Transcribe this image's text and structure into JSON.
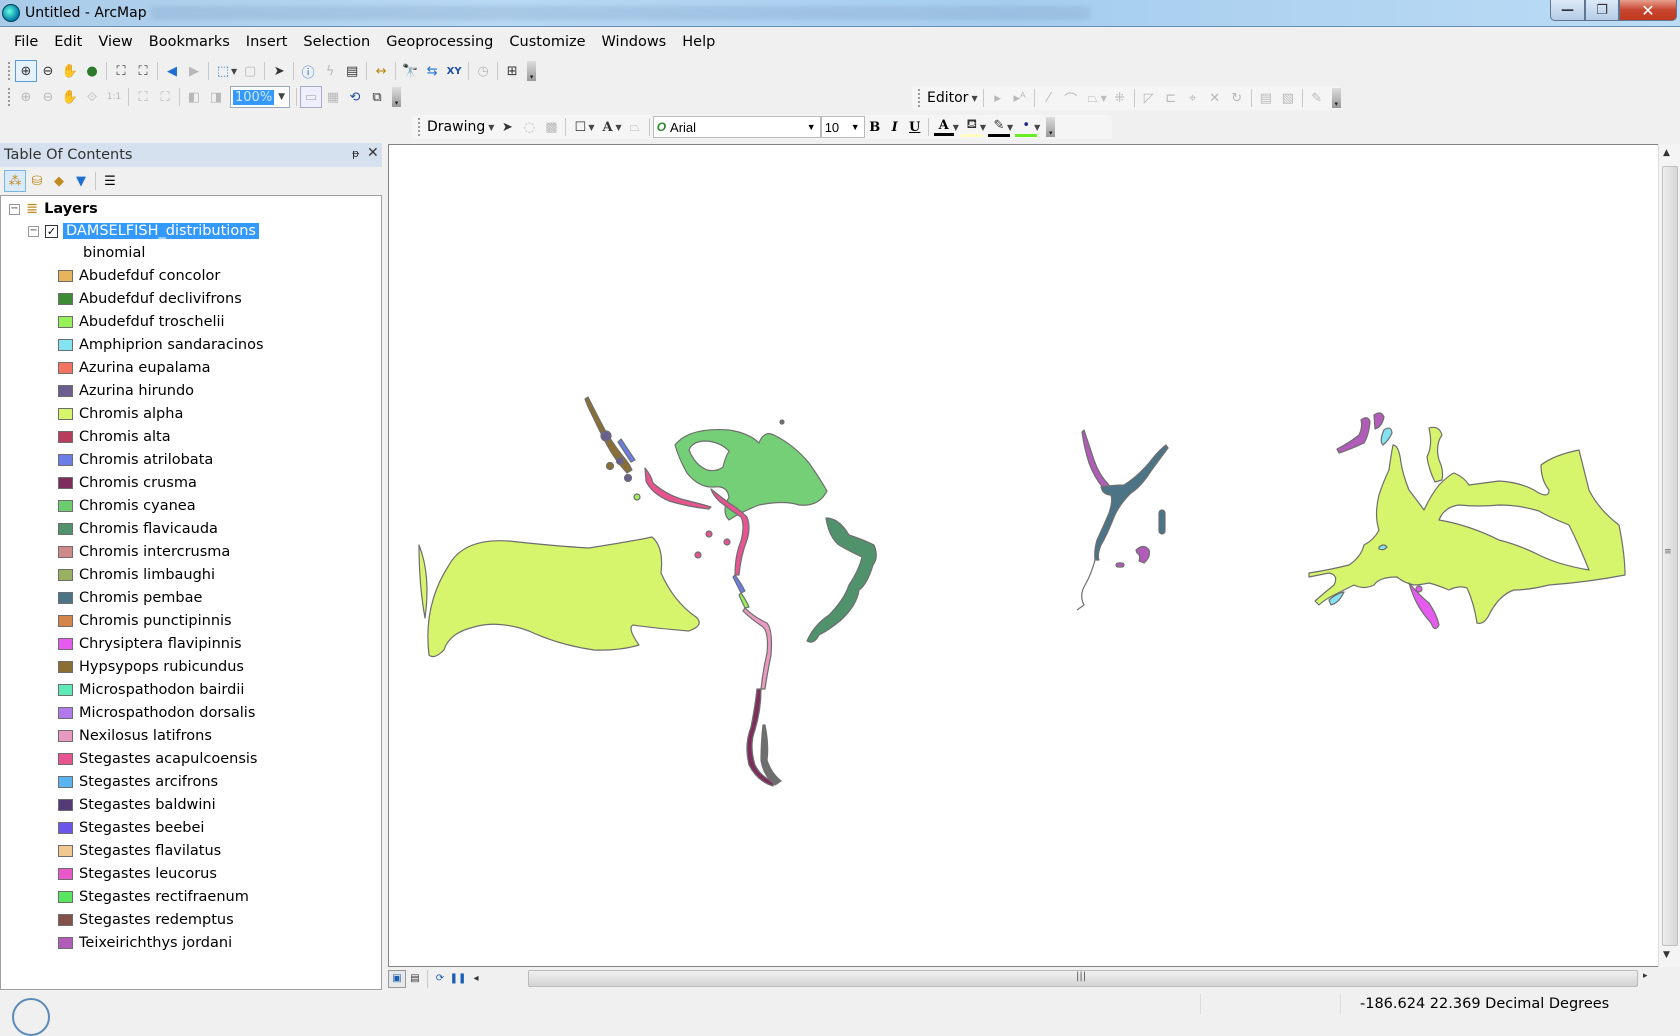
{
  "window": {
    "title": "Untitled - ArcMap",
    "controls": {
      "minimize": "—",
      "maximize": "❐",
      "close": "✕"
    }
  },
  "menubar": {
    "items": [
      "File",
      "Edit",
      "View",
      "Bookmarks",
      "Insert",
      "Selection",
      "Geoprocessing",
      "Customize",
      "Windows",
      "Help"
    ]
  },
  "tools_toolbar": {
    "icons": [
      "zoom-in",
      "zoom-out",
      "pan",
      "full-extent",
      "fixed-zoom-in",
      "fixed-zoom-out",
      "go-back",
      "go-forward",
      "select-features",
      "clear-selection",
      "select-elements",
      "identify",
      "hyperlink",
      "html-popup",
      "measure",
      "find",
      "find-route",
      "go-to-xy",
      "time-slider",
      "create-viewer-window"
    ]
  },
  "layout_toolbar": {
    "zoom_value": "100%",
    "icons": [
      "layout-zoom-in",
      "layout-zoom-out",
      "layout-pan",
      "zoom-whole-page",
      "zoom-100",
      "fixed-zoom-in",
      "fixed-zoom-out",
      "back-extent",
      "forward-extent",
      "toggle-draft-mode",
      "focus-data-frame",
      "change-layout",
      "data-driven-pages"
    ]
  },
  "editor_toolbar": {
    "label": "Editor"
  },
  "drawing_toolbar": {
    "label": "Drawing",
    "font_name": "Arial",
    "font_size": "10",
    "bold": "B",
    "italic": "I",
    "underline": "U",
    "text_color_label": "A",
    "colors": {
      "font": "#000000",
      "fill": "#ffffc0",
      "line": "#000000",
      "marker": "#66ee22"
    }
  },
  "toc": {
    "title": "Table Of Contents",
    "pin": "ᵽ",
    "close": "✕",
    "root_label": "Layers",
    "layer_name": "DAMSELFISH_distributions",
    "layer_checked": true,
    "field_name": "binomial",
    "legend": [
      {
        "label": "Abudefduf concolor",
        "color": "#e6b45a"
      },
      {
        "label": "Abudefduf declivifrons",
        "color": "#3f8a35"
      },
      {
        "label": "Abudefduf troschelii",
        "color": "#98f05a"
      },
      {
        "label": "Amphiprion sandaracinos",
        "color": "#84e3f0"
      },
      {
        "label": "Azurina eupalama",
        "color": "#f57560"
      },
      {
        "label": "Azurina hirundo",
        "color": "#6b5e8e"
      },
      {
        "label": "Chromis alpha",
        "color": "#d6f56c"
      },
      {
        "label": "Chromis alta",
        "color": "#b83c5e"
      },
      {
        "label": "Chromis atrilobata",
        "color": "#6b7ee8"
      },
      {
        "label": "Chromis crusma",
        "color": "#7e2e5c"
      },
      {
        "label": "Chromis cyanea",
        "color": "#6dcc70"
      },
      {
        "label": "Chromis flavicauda",
        "color": "#4f926c"
      },
      {
        "label": "Chromis intercrusma",
        "color": "#cf8a88"
      },
      {
        "label": "Chromis limbaughi",
        "color": "#98b060"
      },
      {
        "label": "Chromis pembae",
        "color": "#4c7487"
      },
      {
        "label": "Chromis punctipinnis",
        "color": "#d5844a"
      },
      {
        "label": "Chrysiptera flavipinnis",
        "color": "#e65bef"
      },
      {
        "label": "Hypsypops rubicundus",
        "color": "#8a6e34"
      },
      {
        "label": "Microspathodon bairdii",
        "color": "#5eeab6"
      },
      {
        "label": "Microspathodon dorsalis",
        "color": "#b07aed"
      },
      {
        "label": "Nexilosus latifrons",
        "color": "#e89ac0"
      },
      {
        "label": "Stegastes acapulcoensis",
        "color": "#e85490"
      },
      {
        "label": "Stegastes arcifrons",
        "color": "#5ab4f2"
      },
      {
        "label": "Stegastes baldwini",
        "color": "#553a78"
      },
      {
        "label": "Stegastes beebei",
        "color": "#6a56e8"
      },
      {
        "label": "Stegastes flavilatus",
        "color": "#f0c890"
      },
      {
        "label": "Stegastes leucorus",
        "color": "#e858c8"
      },
      {
        "label": "Stegastes rectifraenum",
        "color": "#58e560"
      },
      {
        "label": "Stegastes redemptus",
        "color": "#83504a"
      },
      {
        "label": "Teixeirichthys jordani",
        "color": "#b05cb8"
      }
    ]
  },
  "map": {
    "outline_color": "#6e6e6e"
  },
  "status": {
    "coordinates": "-186.624  22.369 Decimal Degrees"
  }
}
